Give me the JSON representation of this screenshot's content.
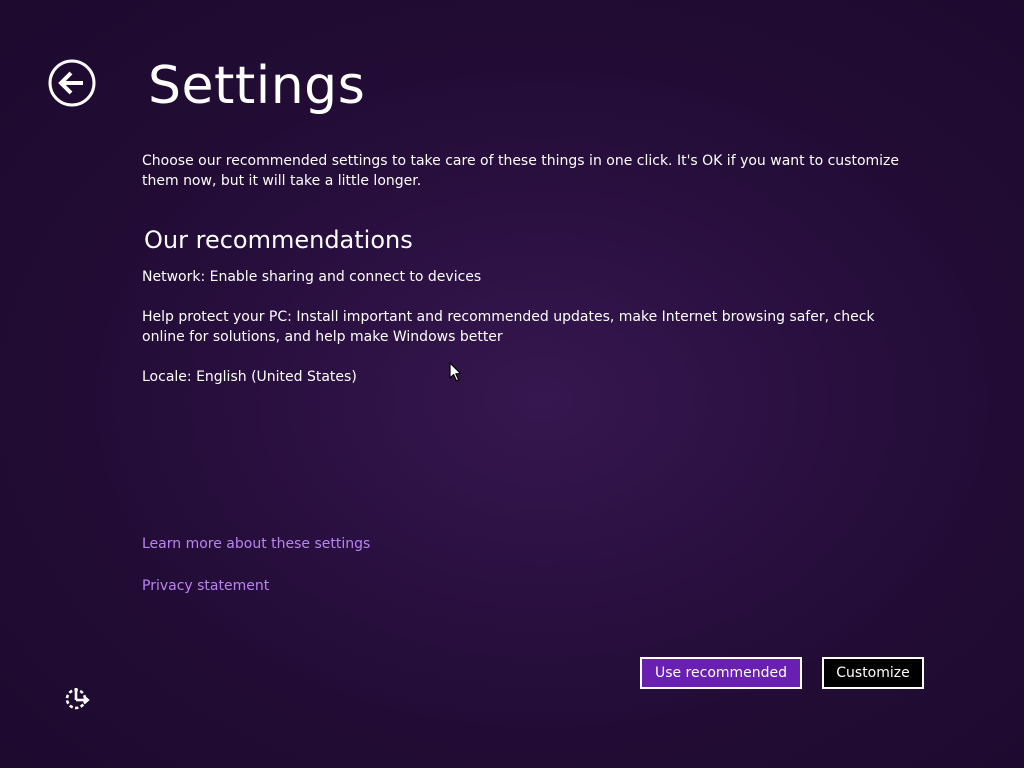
{
  "window": {
    "title": "Settings"
  },
  "intro": {
    "text": "Choose our recommended settings to take care of these things in one click. It's OK if you want to customize them now, but it will take a little longer."
  },
  "recommendations": {
    "heading": "Our recommendations",
    "network": "Network: Enable sharing and connect to devices",
    "protect": "Help protect your PC: Install important and recommended updates, make Internet browsing safer, check online for solutions, and help make Windows better",
    "locale": "Locale:  English (United States)"
  },
  "links": {
    "learn_more": "Learn more about these settings",
    "privacy": "Privacy statement"
  },
  "buttons": {
    "use_recommended": "Use recommended",
    "customize": "Customize"
  },
  "icons": {
    "back": "back-arrow-icon",
    "ease_of_access": "ease-of-access-icon",
    "cursor": "mouse-pointer-icon"
  },
  "colors": {
    "background": "#2b1042",
    "link": "#b985ee",
    "primary_button": "#6a1fb3",
    "secondary_button": "#000000",
    "text": "#ffffff"
  }
}
